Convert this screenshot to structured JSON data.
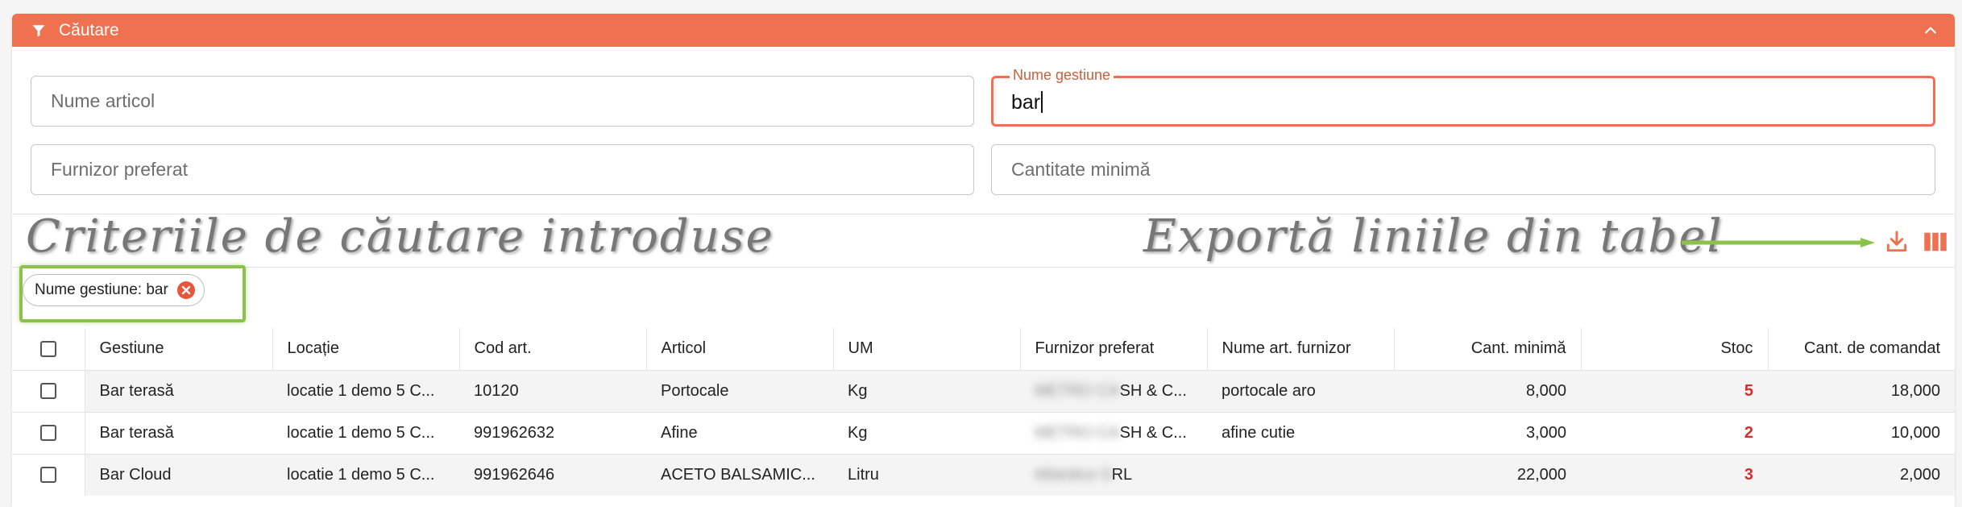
{
  "search": {
    "header_title": "Căutare",
    "fields": {
      "nume_articol": {
        "placeholder": "Nume articol",
        "value": ""
      },
      "nume_gestiune": {
        "label": "Nume gestiune",
        "value": "bar"
      },
      "furnizor_preferat": {
        "placeholder": "Furnizor preferat",
        "value": ""
      },
      "cantitate_minima": {
        "placeholder": "Cantitate minimă",
        "value": ""
      }
    }
  },
  "annotations": {
    "criteria": "Criteriile de căutare introduse",
    "export": "Exportă liniile din tabel"
  },
  "active_filters": [
    {
      "label": "Nume gestiune: bar"
    }
  ],
  "colors": {
    "accent": "#ef7150",
    "highlight": "#8bc34a",
    "stock_alert": "#d32f2f"
  },
  "table": {
    "columns": [
      "Gestiune",
      "Locație",
      "Cod art.",
      "Articol",
      "UM",
      "Furnizor preferat",
      "Nume art. furnizor",
      "Cant. minimă",
      "Stoc",
      "Cant. de comandat"
    ],
    "rows": [
      {
        "gestiune": "Bar terasă",
        "locatie": "locatie 1 demo 5 C...",
        "cod": "10120",
        "articol": "Portocale",
        "um": "Kg",
        "furnizor_hidden": "METRO CA",
        "furnizor_visible": "SH & C...",
        "nume_art_furnizor": "portocale aro",
        "cant_minima": "8,000",
        "stoc": "5",
        "cant_comandat": "18,000"
      },
      {
        "gestiune": "Bar terasă",
        "locatie": "locatie 1 demo 5 C...",
        "cod": "991962632",
        "articol": "Afine",
        "um": "Kg",
        "furnizor_hidden": "METRO CA",
        "furnizor_visible": "SH & C...",
        "nume_art_furnizor": "afine cutie",
        "cant_minima": "3,000",
        "stoc": "2",
        "cant_comandat": "10,000"
      },
      {
        "gestiune": "Bar Cloud",
        "locatie": "locatie 1 demo 5 C...",
        "cod": "991962646",
        "articol": "ACETO BALSAMIC...",
        "um": "Litru",
        "furnizor_hidden": "Atlantico S",
        "furnizor_visible": "RL",
        "nume_art_furnizor": "",
        "cant_minima": "22,000",
        "stoc": "3",
        "cant_comandat": "2,000"
      }
    ]
  }
}
